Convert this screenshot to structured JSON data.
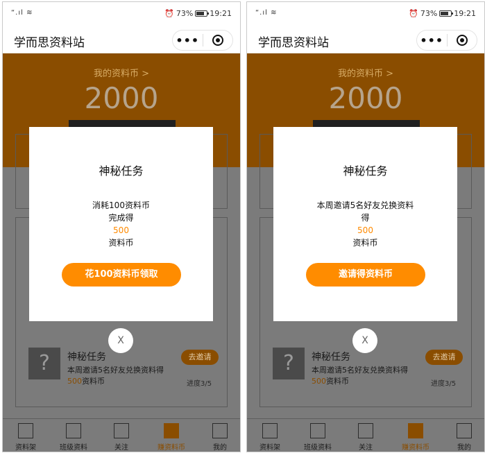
{
  "screens": [
    {
      "status": {
        "signal": "4G",
        "battery": "73%",
        "time": "19:21"
      },
      "header": {
        "title": "学而思资料站",
        "more_icon": "•••"
      },
      "banner": {
        "coin_label": "我的资料币 >",
        "coin_amount": "2000"
      },
      "task": {
        "icon": "?",
        "title": "神秘任务",
        "desc_prefix": "本周邀请5名好友兑换资料得",
        "desc_amount": "500",
        "desc_suffix": "资料币",
        "button": "去邀请",
        "progress": "进度3/5"
      },
      "modal": {
        "title": "神秘任务",
        "line1": "消耗100资料币",
        "line2_prefix": "完成得",
        "line2_amount": "500",
        "line2_suffix": "资料币",
        "button": "花100资料币领取",
        "close": "X"
      },
      "tabs": [
        {
          "label": "资料架"
        },
        {
          "label": "班级资料"
        },
        {
          "label": "关注"
        },
        {
          "label": "赚资料币"
        },
        {
          "label": "我的"
        }
      ]
    },
    {
      "status": {
        "signal": "4G",
        "battery": "73%",
        "time": "19:21"
      },
      "header": {
        "title": "学而思资料站",
        "more_icon": "•••"
      },
      "banner": {
        "coin_label": "我的资料币 >",
        "coin_amount": "2000"
      },
      "task": {
        "icon": "?",
        "title": "神秘任务",
        "desc_prefix": "本周邀请5名好友兑换资料得",
        "desc_amount": "500",
        "desc_suffix": "资料币",
        "button": "去邀请",
        "progress": "进度3/5"
      },
      "modal": {
        "title": "神秘任务",
        "line1": "本周邀请5名好友兑换资料",
        "line2_prefix": "得",
        "line2_amount": "500",
        "line2_suffix": "资料币",
        "button": "邀请得资料币",
        "close": "X"
      },
      "tabs": [
        {
          "label": "资料架"
        },
        {
          "label": "班级资料"
        },
        {
          "label": "关注"
        },
        {
          "label": "赚资料币"
        },
        {
          "label": "我的"
        }
      ]
    }
  ],
  "active_tab": "赚资料币",
  "colors": {
    "brand_orange": "#ff8c00",
    "dimmed_brand": "#8a4d00",
    "overlay_gray": "#7b7b7b"
  }
}
